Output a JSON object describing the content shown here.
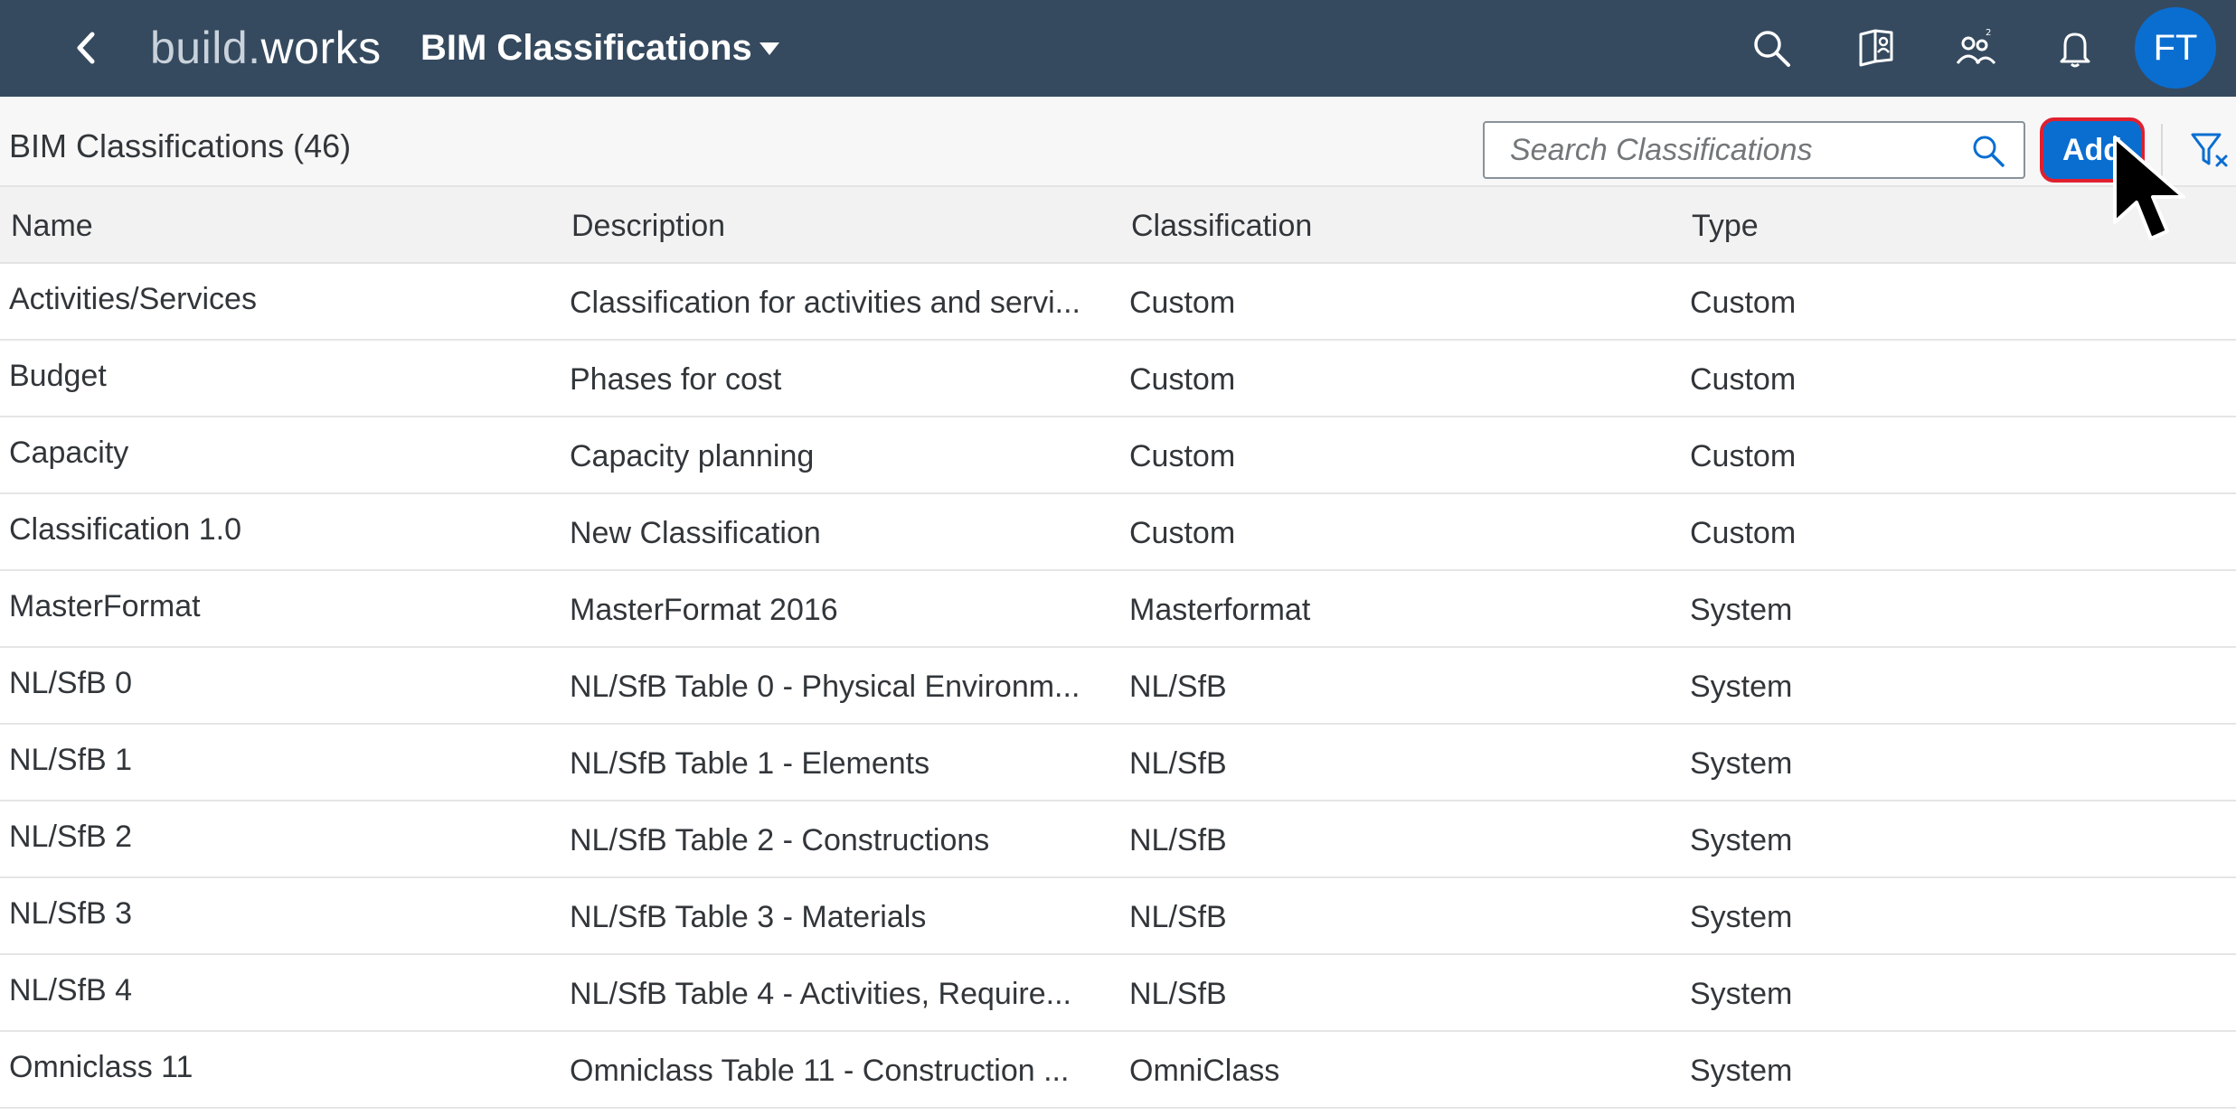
{
  "shell": {
    "logo_part1": "build.",
    "logo_part2": "works",
    "app_title": "BIM Classifications",
    "avatar_initials": "FT",
    "icons": [
      "back-chevron-icon",
      "dropdown-caret-icon",
      "search-icon",
      "project-book-icon",
      "team-members-icon",
      "bell-icon"
    ]
  },
  "toolbar": {
    "title": "BIM Classifications (46)",
    "search_placeholder": "Search Classifications",
    "add_label": "Add",
    "icons": [
      "search-icon",
      "filter-clear-icon"
    ]
  },
  "table": {
    "columns": [
      "Name",
      "Description",
      "Classification",
      "Type"
    ],
    "rows": [
      {
        "name": "Activities/Services",
        "description": "Classification for activities and servi...",
        "classification": "Custom",
        "type": "Custom"
      },
      {
        "name": "Budget",
        "description": "Phases for cost",
        "classification": "Custom",
        "type": "Custom"
      },
      {
        "name": "Capacity",
        "description": "Capacity planning",
        "classification": "Custom",
        "type": "Custom"
      },
      {
        "name": "Classification 1.0",
        "description": "New Classification",
        "classification": "Custom",
        "type": "Custom"
      },
      {
        "name": "MasterFormat",
        "description": "MasterFormat 2016",
        "classification": "Masterformat",
        "type": "System"
      },
      {
        "name": "NL/SfB 0",
        "description": "NL/SfB Table 0 - Physical Environm...",
        "classification": "NL/SfB",
        "type": "System"
      },
      {
        "name": "NL/SfB 1",
        "description": "NL/SfB Table 1 - Elements",
        "classification": "NL/SfB",
        "type": "System"
      },
      {
        "name": "NL/SfB 2",
        "description": "NL/SfB Table 2 - Constructions",
        "classification": "NL/SfB",
        "type": "System"
      },
      {
        "name": "NL/SfB 3",
        "description": "NL/SfB Table 3 - Materials",
        "classification": "NL/SfB",
        "type": "System"
      },
      {
        "name": "NL/SfB 4",
        "description": "NL/SfB Table 4 - Activities, Require...",
        "classification": "NL/SfB",
        "type": "System"
      },
      {
        "name": "Omniclass 11",
        "description": "Omniclass Table 11 - Construction ...",
        "classification": "OmniClass",
        "type": "System"
      }
    ]
  },
  "colors": {
    "shell_bg": "#354a5f",
    "accent": "#0a6ed1",
    "highlight": "#e0202f"
  }
}
